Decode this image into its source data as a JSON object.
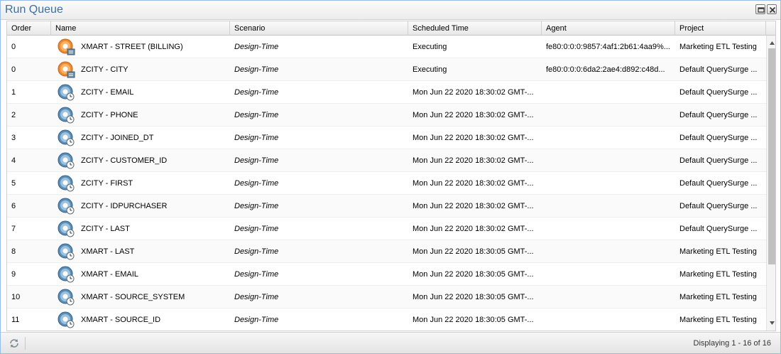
{
  "window": {
    "title": "Run Queue"
  },
  "columns": {
    "order": "Order",
    "name": "Name",
    "scenario": "Scenario",
    "scheduled_time": "Scheduled Time",
    "agent": "Agent",
    "project": "Project"
  },
  "rows": [
    {
      "order": "0",
      "status_icon": "executing-icon",
      "name": "XMART - STREET (BILLING)",
      "scenario": "Design-Time",
      "scheduled_time": "Executing",
      "agent": "fe80:0:0:0:9857:4af1:2b61:4aa9%...",
      "project": "Marketing ETL Testing"
    },
    {
      "order": "0",
      "status_icon": "executing-icon",
      "name": "ZCITY - CITY",
      "scenario": "Design-Time",
      "scheduled_time": "Executing",
      "agent": "fe80:0:0:0:6da2:2ae4:d892:c48d...",
      "project": "Default QuerySurge ..."
    },
    {
      "order": "1",
      "status_icon": "queued-icon",
      "name": "ZCITY - EMAIL",
      "scenario": "Design-Time",
      "scheduled_time": "Mon Jun 22 2020 18:30:02 GMT-...",
      "agent": "",
      "project": "Default QuerySurge ..."
    },
    {
      "order": "2",
      "status_icon": "queued-icon",
      "name": "ZCITY - PHONE",
      "scenario": "Design-Time",
      "scheduled_time": "Mon Jun 22 2020 18:30:02 GMT-...",
      "agent": "",
      "project": "Default QuerySurge ..."
    },
    {
      "order": "3",
      "status_icon": "queued-icon",
      "name": "ZCITY - JOINED_DT",
      "scenario": "Design-Time",
      "scheduled_time": "Mon Jun 22 2020 18:30:02 GMT-...",
      "agent": "",
      "project": "Default QuerySurge ..."
    },
    {
      "order": "4",
      "status_icon": "queued-icon",
      "name": "ZCITY - CUSTOMER_ID",
      "scenario": "Design-Time",
      "scheduled_time": "Mon Jun 22 2020 18:30:02 GMT-...",
      "agent": "",
      "project": "Default QuerySurge ..."
    },
    {
      "order": "5",
      "status_icon": "queued-icon",
      "name": "ZCITY - FIRST",
      "scenario": "Design-Time",
      "scheduled_time": "Mon Jun 22 2020 18:30:02 GMT-...",
      "agent": "",
      "project": "Default QuerySurge ..."
    },
    {
      "order": "6",
      "status_icon": "queued-icon",
      "name": "ZCITY - IDPURCHASER",
      "scenario": "Design-Time",
      "scheduled_time": "Mon Jun 22 2020 18:30:02 GMT-...",
      "agent": "",
      "project": "Default QuerySurge ..."
    },
    {
      "order": "7",
      "status_icon": "queued-icon",
      "name": "ZCITY - LAST",
      "scenario": "Design-Time",
      "scheduled_time": "Mon Jun 22 2020 18:30:02 GMT-...",
      "agent": "",
      "project": "Default QuerySurge ..."
    },
    {
      "order": "8",
      "status_icon": "queued-icon",
      "name": "XMART - LAST",
      "scenario": "Design-Time",
      "scheduled_time": "Mon Jun 22 2020 18:30:05 GMT-...",
      "agent": "",
      "project": "Marketing ETL Testing"
    },
    {
      "order": "9",
      "status_icon": "queued-icon",
      "name": "XMART - EMAIL",
      "scenario": "Design-Time",
      "scheduled_time": "Mon Jun 22 2020 18:30:05 GMT-...",
      "agent": "",
      "project": "Marketing ETL Testing"
    },
    {
      "order": "10",
      "status_icon": "queued-icon",
      "name": "XMART - SOURCE_SYSTEM",
      "scenario": "Design-Time",
      "scheduled_time": "Mon Jun 22 2020 18:30:05 GMT-...",
      "agent": "",
      "project": "Marketing ETL Testing"
    },
    {
      "order": "11",
      "status_icon": "queued-icon",
      "name": "XMART - SOURCE_ID",
      "scenario": "Design-Time",
      "scheduled_time": "Mon Jun 22 2020 18:30:05 GMT-...",
      "agent": "",
      "project": "Marketing ETL Testing"
    }
  ],
  "footer": {
    "paging_info": "Displaying 1 - 16 of 16"
  },
  "tools": {
    "restore": "restore-icon",
    "close": "close-icon",
    "refresh": "refresh-icon"
  },
  "colors": {
    "title": "#3d6fa0",
    "executing": "#e8731c",
    "queued": "#4a7fa8"
  }
}
